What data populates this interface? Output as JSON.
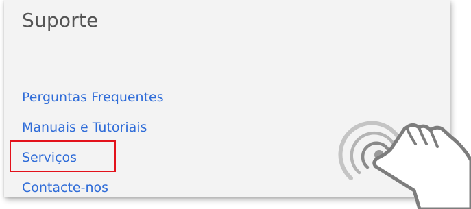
{
  "menu": {
    "title": "Suporte",
    "items": [
      {
        "label": "Perguntas Frequentes"
      },
      {
        "label": "Manuais e Tutoriais"
      },
      {
        "label": "Serviços"
      },
      {
        "label": "Contacte-nos"
      }
    ]
  },
  "colors": {
    "panel_background": "#f3f3f3",
    "title_text": "#545454",
    "link": "#2f6cd8",
    "highlight_border": "#e3121b"
  },
  "icons": {
    "tap_gesture": "hand-pointer-icon"
  }
}
